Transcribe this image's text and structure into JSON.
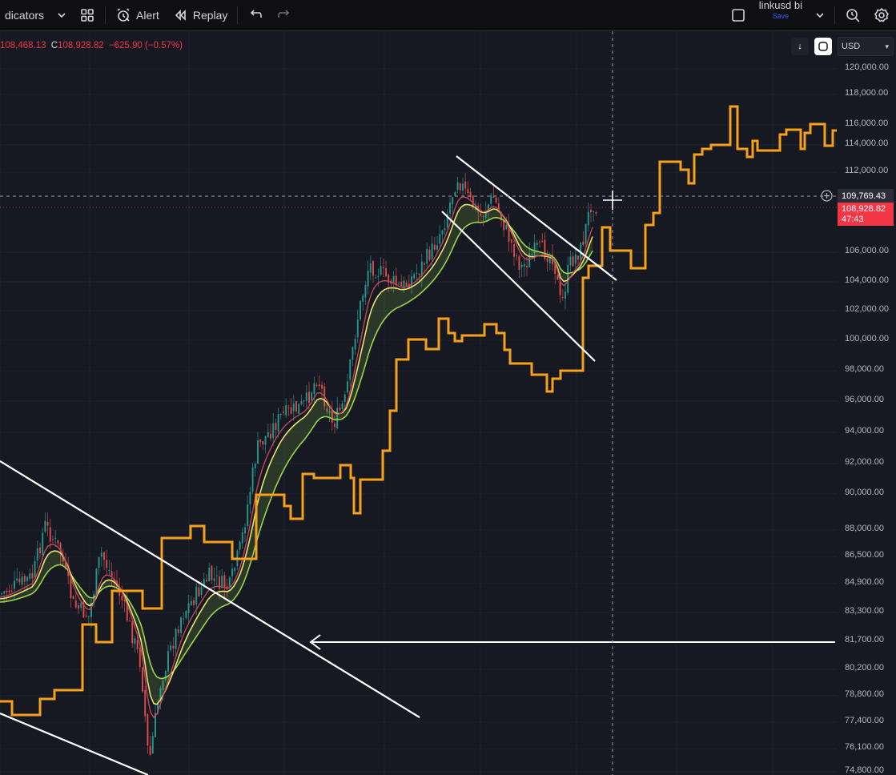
{
  "toolbar": {
    "indicators_label": "dicators",
    "alert_label": "Alert",
    "replay_label": "Replay",
    "layout_name": "linkusd bi",
    "layout_save": "Save"
  },
  "legend": {
    "low_value": "108,468.13",
    "close_label": "C",
    "close_value": "108,928.82",
    "change": "−625.90 (−0.57%)"
  },
  "price_scale": {
    "currency": "USD",
    "ticks": [
      "120,000.00",
      "118,000.00",
      "116,000.00",
      "114,000.00",
      "112,000.00",
      "106,000.00",
      "104,000.00",
      "102,000.00",
      "100,000.00",
      "98,000.00",
      "96,000.00",
      "94,000.00",
      "92,000.00",
      "90,000.00",
      "88,000.00",
      "86,500.00",
      "84,900.00",
      "83,300.00",
      "81,700.00",
      "80,200.00",
      "78,800.00",
      "77,400.00",
      "76,100.00",
      "74,800.00"
    ],
    "crosshair_price": "109,769.43",
    "last_price": "108,928.82",
    "countdown": "47:43"
  },
  "colors": {
    "background": "#161922",
    "orange_line": "#f7a11a",
    "ema_fast": "#e8e26a",
    "ema_slow": "#9bd44c",
    "candle_up": "#26a69a",
    "candle_down": "#ef5350",
    "trendline": "#ffffff"
  }
}
